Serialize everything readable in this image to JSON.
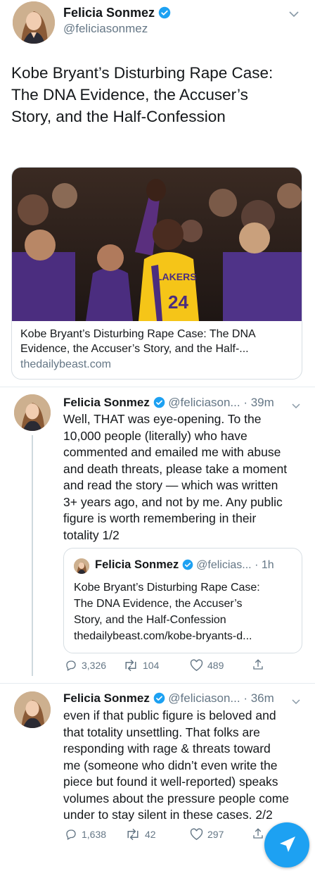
{
  "main_tweet": {
    "author_name": "Felicia Sonmez",
    "handle": "@feliciasonmez",
    "text": "Kobe Bryant’s Disturbing Rape Case:\nThe DNA Evidence, the Accuser’s\nStory, and the Half-Confession",
    "card": {
      "image_jersey_text": "LAKERS",
      "image_number": "24",
      "title": "Kobe Bryant’s Disturbing Rape Case: The DNA\nEvidence, the Accuser’s Story, and the Half-...",
      "domain": "thedailybeast.com"
    }
  },
  "replies": [
    {
      "author_name": "Felicia Sonmez",
      "handle": "@feliciason...",
      "time": "· 39m",
      "text": "Well, THAT was eye-opening. To the\n10,000 people (literally) who have\ncommented and emailed me with abuse\nand death threats, please take a moment\nand read the story — which was written\n3+ years ago, and not by me. Any public\nfigure is worth remembering in their\ntotality 1/2",
      "quote": {
        "author_name": "Felicia Sonmez",
        "handle": "@felicias...",
        "time": "· 1h",
        "text": "Kobe Bryant’s Disturbing Rape Case:\nThe DNA Evidence, the Accuser’s\nStory, and the Half-Confession\nthedailybeast.com/kobe-bryants-d..."
      },
      "actions": {
        "replies": "3,326",
        "retweets": "104",
        "likes": "489"
      }
    },
    {
      "author_name": "Felicia Sonmez",
      "handle": "@feliciason...",
      "time": "· 36m",
      "text": "even if that public figure is beloved and\nthat totality unsettling. That folks are\nresponding with rage & threats toward\nme (someone who didn’t even write the\npiece but found it well-reported) speaks\nvolumes about the pressure people come\nunder to stay silent in these cases. 2/2",
      "actions": {
        "replies": "1,638",
        "retweets": "42",
        "likes": "297"
      }
    }
  ],
  "colors": {
    "accent": "#1da1f2",
    "gray": "#657786",
    "border": "#d7dee3"
  },
  "icons": [
    "verified-badge-icon",
    "chevron-down-icon",
    "reply-icon",
    "retweet-icon",
    "like-icon",
    "share-icon",
    "compose-fab-icon"
  ]
}
